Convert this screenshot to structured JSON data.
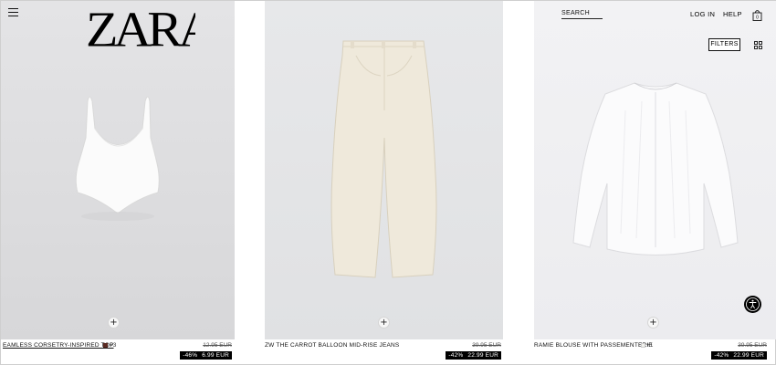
{
  "header": {
    "brand": "ZARA",
    "search_label": "SEARCH",
    "login_label": "LOG IN",
    "help_label": "HELP",
    "bag_count": "0",
    "filters_label": "FILTERS"
  },
  "products": [
    {
      "name": "EAMLESS CORSETRY-INSPIRED TOP",
      "extra_colors": "+3",
      "swatch_color": "#5a2a22",
      "old_price": "12.95 EUR",
      "discount": "-46%",
      "price": "6.99 EUR"
    },
    {
      "name": "ZW THE CARROT BALLOON MID-RISE JEANS",
      "old_price": "39.95 EUR",
      "discount": "-42%",
      "price": "22.99 EUR"
    },
    {
      "name": "RAMIE BLOUSE WITH PASSEMENTERIE",
      "extra_colors": "+1",
      "swatch_color": "#f1f1ec",
      "old_price": "39.95 EUR",
      "discount": "-42%",
      "price": "22.99 EUR"
    }
  ],
  "add_button_label": "+",
  "icons": {
    "menu": "menu-icon",
    "bag": "shopping-bag-icon",
    "grid": "grid-view-icon",
    "accessibility": "accessibility-icon"
  }
}
